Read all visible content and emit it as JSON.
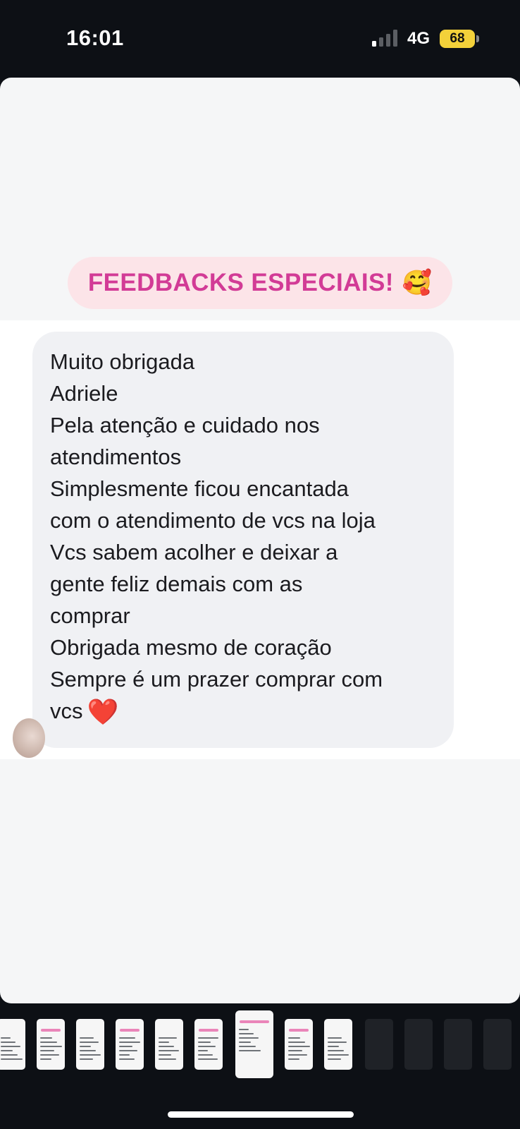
{
  "status_bar": {
    "time": "16:01",
    "network": "4G",
    "battery": "68",
    "signal_bars_active": 1,
    "signal_bars_total": 4
  },
  "story": {
    "title": "FEEDBACKS ESPECIAIS!",
    "title_emoji": "🥰",
    "title_color": "#d23b96",
    "message_lines": [
      "Muito obrigada",
      "Adriele",
      "Pela atenção e cuidado nos",
      "atendimentos",
      "Simplesmente ficou encantada",
      "com o atendimento de vcs na loja",
      "Vcs sabem acolher e deixar a",
      "gente feliz demais com as",
      "comprar",
      "Obrigada mesmo de coração",
      "Sempre é um prazer comprar com",
      "vcs"
    ],
    "end_emoji": "❤️"
  },
  "thumbnails": {
    "count": 13,
    "active_index": 6,
    "empty_from_index": 9
  }
}
